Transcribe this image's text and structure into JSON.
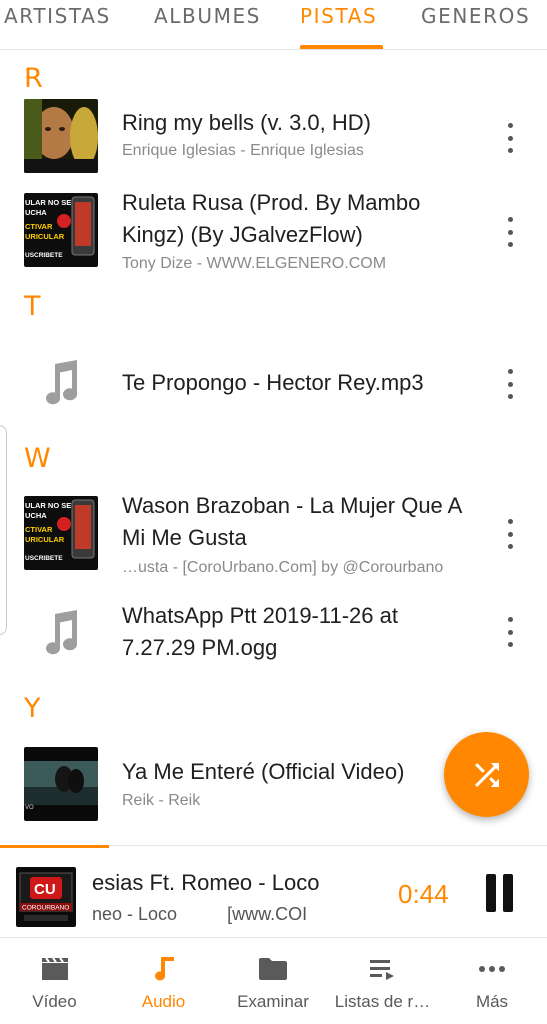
{
  "tabs": [
    {
      "label": "ARTISTAS"
    },
    {
      "label": "ALBUMES"
    },
    {
      "label": "PISTAS"
    },
    {
      "label": "GENEROS"
    }
  ],
  "active_tab": "PISTAS",
  "sections": [
    {
      "letter": "R"
    },
    {
      "letter": "T"
    },
    {
      "letter": "W"
    },
    {
      "letter": "Y"
    }
  ],
  "tracks": [
    {
      "title": "Ring my bells (v. 3.0, HD)",
      "subtitle": "Enrique Iglesias - Enrique Iglesias",
      "art": "photo"
    },
    {
      "title": "Ruleta Rusa (Prod. By Mambo Kingz) (By JGalvezFlow)",
      "subtitle": "Tony Dize - WWW.ELGENERO.COM",
      "art": "promo",
      "art_text": [
        "ULAR NO SE",
        "UCHA",
        "CTIVAR",
        "URICULAR",
        "USCRIBETE"
      ]
    },
    {
      "title": "Te Propongo - Hector Rey.mp3",
      "subtitle": "",
      "art": "note-icon"
    },
    {
      "title": "Wason Brazoban - La Mujer Que A Mi Me Gusta",
      "subtitle": "…usta - [CoroUrbano.Com] by @Corourbano",
      "art": "promo",
      "art_text": [
        "ULAR NO SE",
        "UCHA",
        "CTIVAR",
        "URICULAR",
        "USCRIBETE"
      ]
    },
    {
      "title": "WhatsApp Ptt 2019-11-26 at 7.27.29 PM.ogg",
      "subtitle": "",
      "art": "note-icon"
    },
    {
      "title": "Ya Me Enteré (Official Video)",
      "subtitle": "Reik - Reik",
      "art": "video",
      "art_text": "VO"
    }
  ],
  "shuffle_button": {
    "icon": "shuffle-icon"
  },
  "player": {
    "title": "esias Ft. Romeo - Loco",
    "subtitle": "neo - Loco          [www.COI",
    "time": "0:44",
    "art_text": "COROURBANO",
    "progress": 0.2
  },
  "bottom_nav": [
    {
      "label": "Vídeo",
      "icon": "movie-icon"
    },
    {
      "label": "Audio",
      "icon": "music-note-icon"
    },
    {
      "label": "Examinar",
      "icon": "folder-icon"
    },
    {
      "label": "Listas de r…",
      "icon": "playlist-icon"
    },
    {
      "label": "Más",
      "icon": "more-horizontal-icon"
    }
  ],
  "active_nav": "Audio",
  "colors": {
    "accent": "#ff8800",
    "text": "#202020",
    "secondary_text": "#8a8a8a"
  }
}
